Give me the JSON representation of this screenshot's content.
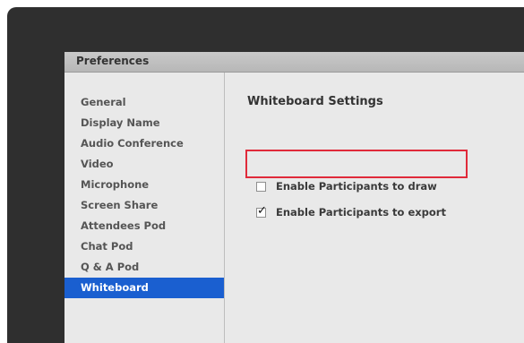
{
  "dialog": {
    "title": "Preferences"
  },
  "sidebar": {
    "items": [
      {
        "label": "General",
        "selected": false
      },
      {
        "label": "Display Name",
        "selected": false
      },
      {
        "label": "Audio Conference",
        "selected": false
      },
      {
        "label": "Video",
        "selected": false
      },
      {
        "label": "Microphone",
        "selected": false
      },
      {
        "label": "Screen Share",
        "selected": false
      },
      {
        "label": "Attendees Pod",
        "selected": false
      },
      {
        "label": "Chat Pod",
        "selected": false
      },
      {
        "label": "Q & A Pod",
        "selected": false
      },
      {
        "label": "Whiteboard",
        "selected": true
      }
    ]
  },
  "content": {
    "section_title": "Whiteboard Settings",
    "options": [
      {
        "label": "Enable Participants to draw",
        "checked": false
      },
      {
        "label": "Enable Participants to export",
        "checked": true
      }
    ]
  },
  "colors": {
    "selection": "#1a5fd0",
    "highlight_box": "#e02a3a",
    "app_background": "#2f2f2f",
    "dialog_background": "#e7e7e7"
  },
  "icons": {
    "checkmark": "✓"
  }
}
